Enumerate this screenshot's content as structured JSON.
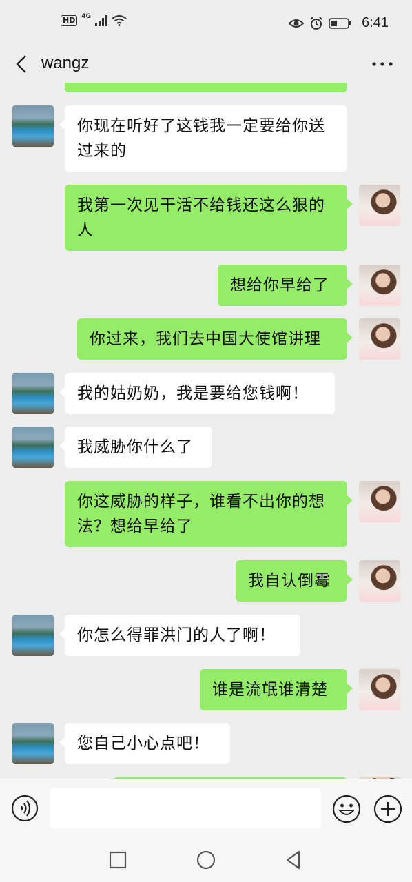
{
  "status_bar": {
    "hd_label": "HD",
    "network_label": "4G",
    "time": "6:41"
  },
  "header": {
    "title": "wangz"
  },
  "messages": [
    {
      "side": "left",
      "text_lines": [
        "你现在听好了这钱我一定要给你送",
        "过来的"
      ]
    },
    {
      "side": "right",
      "text_lines": [
        "我第一次见干活不给钱还这么狠的",
        "人"
      ]
    },
    {
      "side": "right",
      "text_lines": [
        "想给你早给了"
      ]
    },
    {
      "side": "right",
      "text_lines": [
        "你过来，我们去中国大使馆讲理"
      ]
    },
    {
      "side": "left",
      "text_lines": [
        "我的姑奶奶，我是要给您钱啊！"
      ]
    },
    {
      "side": "left",
      "text_lines": [
        "我威胁你什么了"
      ]
    },
    {
      "side": "right",
      "text_lines": [
        "你这威胁的样子，谁看不出你的想",
        "法？想给早给了"
      ]
    },
    {
      "side": "right",
      "text_lines": [
        "我自认倒霉"
      ]
    },
    {
      "side": "left",
      "text_lines": [
        "你怎么得罪洪门的人了啊！"
      ]
    },
    {
      "side": "right",
      "text_lines": [
        "谁是流氓谁清楚"
      ]
    },
    {
      "side": "left",
      "text_lines": [
        "您自己小心点吧！"
      ]
    }
  ],
  "colors": {
    "background": "#ededed",
    "bubble_self": "#95ec69",
    "bubble_other": "#ffffff"
  },
  "icons": {
    "back": "chevron-left-icon",
    "more": "more-dots-icon",
    "voice": "voice-icon",
    "emoji": "emoji-icon",
    "plus": "plus-icon",
    "nav_recent": "square-icon",
    "nav_home": "circle-icon",
    "nav_back": "triangle-back-icon"
  }
}
